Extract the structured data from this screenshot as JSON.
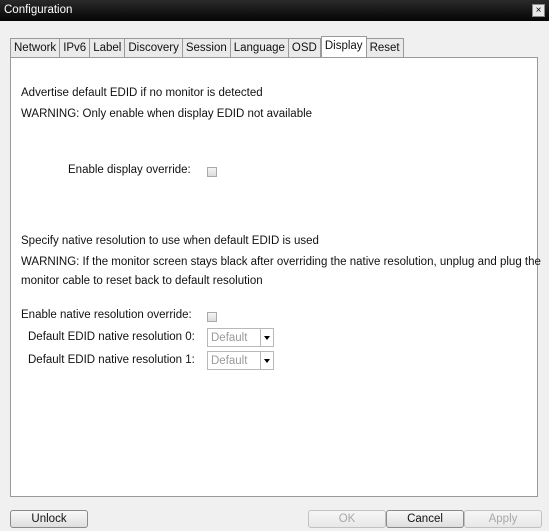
{
  "window": {
    "title": "Configuration",
    "close_label": "×"
  },
  "tabs": [
    {
      "label": "Network"
    },
    {
      "label": "IPv6"
    },
    {
      "label": "Label"
    },
    {
      "label": "Discovery"
    },
    {
      "label": "Session"
    },
    {
      "label": "Language"
    },
    {
      "label": "OSD"
    },
    {
      "label": "Display",
      "active": true
    },
    {
      "label": "Reset"
    }
  ],
  "display": {
    "edid_section": {
      "line1": "Advertise default EDID if no monitor is detected",
      "line2": "WARNING: Only enable when display EDID not available",
      "override_label": "Enable display override:",
      "override_checked": false
    },
    "native_section": {
      "line1": "Specify native resolution to use when default EDID is used",
      "warning_line1": "WARNING: If the monitor screen stays black after overriding the native resolution, unplug and plug the",
      "warning_line2": "monitor cable to reset back to default resolution",
      "override_label": "Enable native resolution override:",
      "override_checked": false,
      "res0_label": "Default EDID native resolution 0:",
      "res0_value": "Default",
      "res1_label": "Default EDID native resolution 1:",
      "res1_value": "Default"
    }
  },
  "buttons": {
    "unlock": "Unlock",
    "ok": "OK",
    "cancel": "Cancel",
    "apply": "Apply"
  }
}
